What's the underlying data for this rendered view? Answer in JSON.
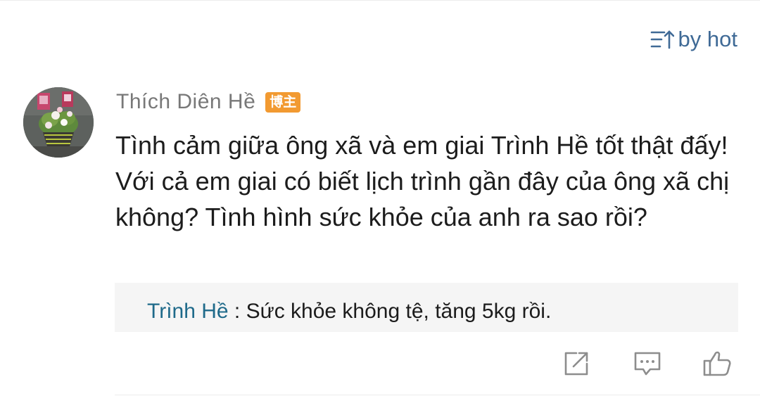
{
  "sort": {
    "label": "by hot",
    "icon": "sort-icon",
    "color": "#3f6a96"
  },
  "comment": {
    "author": "Thích Diên Hề",
    "badge": "博主",
    "badge_color": "#f29a31",
    "avatar_icon": "flower-bouquet-avatar",
    "text": "Tình cảm giữa ông xã và em giai Trình Hề tốt thật đấy! Với cả em giai có biết lịch trình gần đây của ông xã chị không? Tình hình sức khỏe của anh ra sao rồi?",
    "reply": {
      "author": "Trình Hề",
      "separator": " : ",
      "text": "Sức khỏe không tệ, tăng 5kg rồi.",
      "author_color": "#1f6a8a"
    },
    "actions": [
      {
        "name": "share",
        "icon": "share-icon"
      },
      {
        "name": "reply",
        "icon": "comment-icon"
      },
      {
        "name": "like",
        "icon": "thumbs-up-icon"
      }
    ]
  }
}
